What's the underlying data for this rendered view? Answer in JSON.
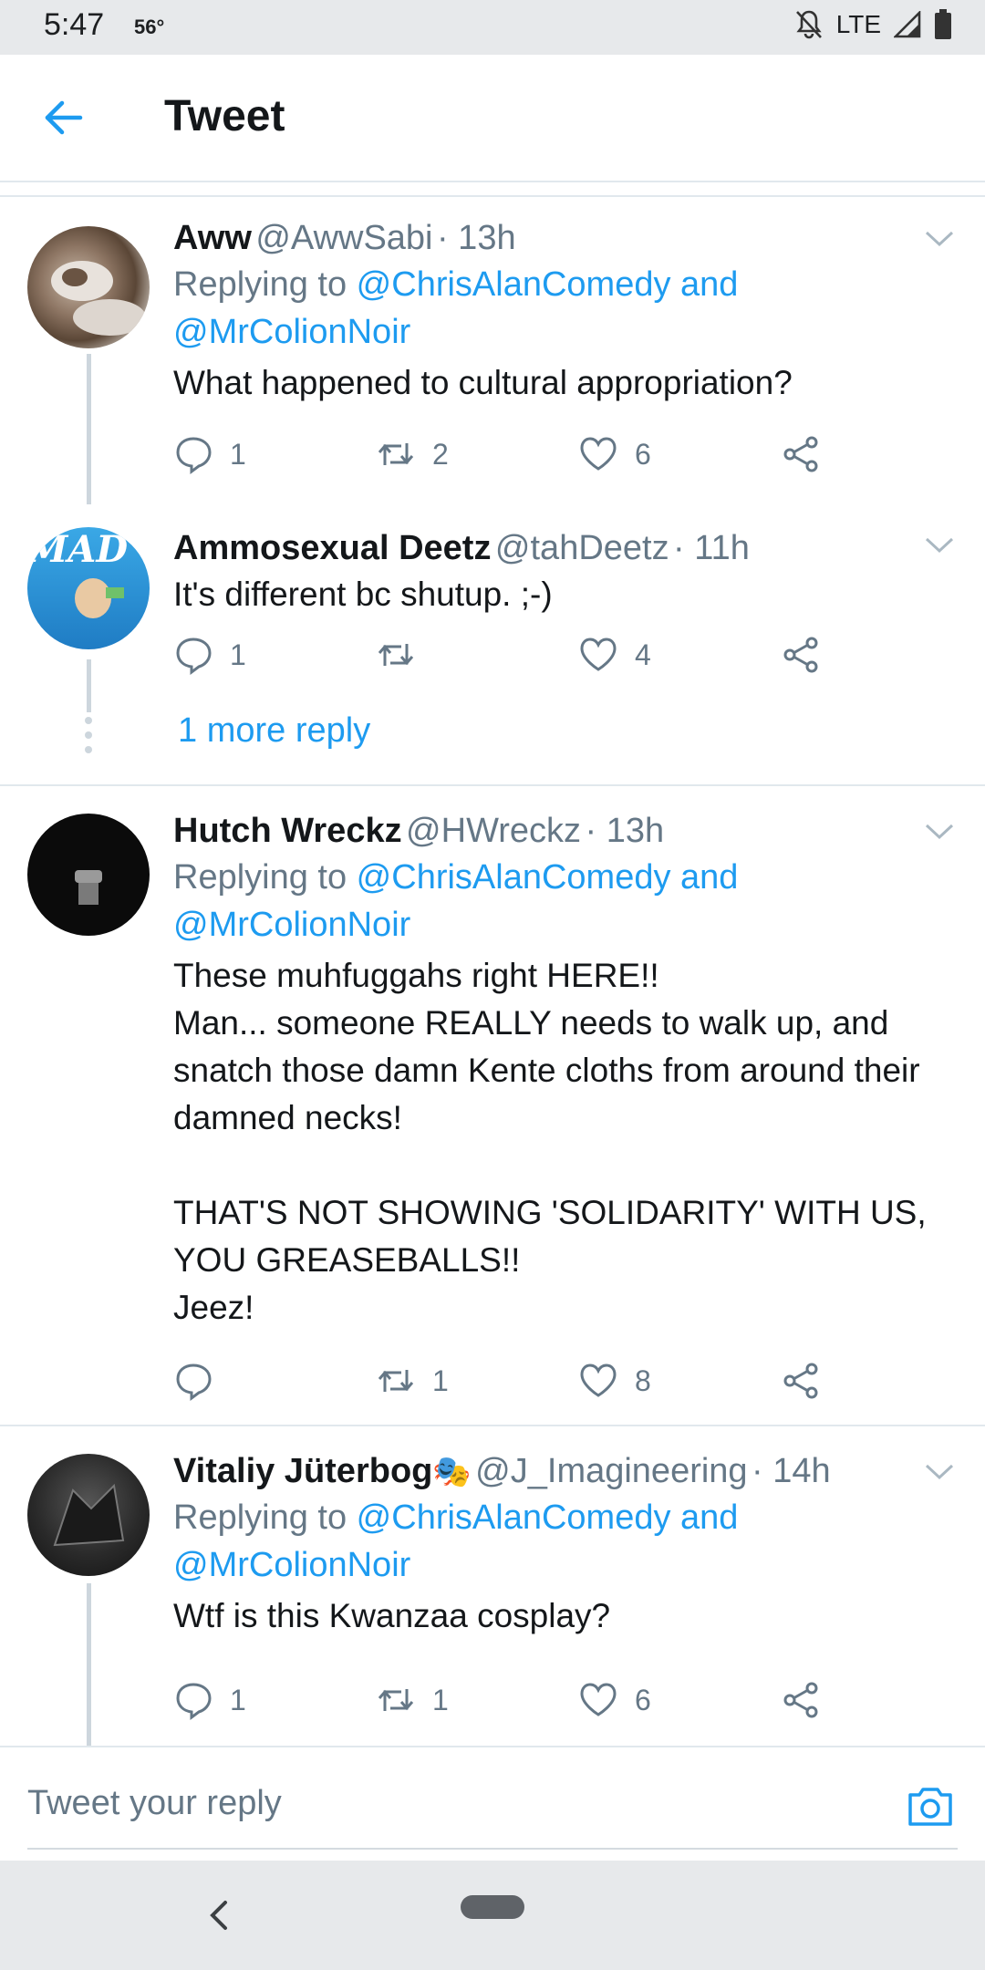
{
  "status": {
    "time": "5:47",
    "temp": "56°",
    "network": "LTE"
  },
  "header": {
    "title": "Tweet"
  },
  "tweets": [
    {
      "name": "Aww",
      "handle": "@AwwSabi",
      "time": "· 13h",
      "replying_prefix": "Replying to ",
      "replying_to": "@ChrisAlanComedy and",
      "replying_to2": "@MrColionNoir",
      "text": "What happened to cultural appropriation?",
      "replies": "1",
      "retweets": "2",
      "likes": "6"
    },
    {
      "name": "Ammosexual Deetz",
      "handle": "@tahDeetz",
      "time": "· 11h",
      "text": "It's different bc shutup. ;-)",
      "replies": "1",
      "retweets": "",
      "likes": "4",
      "more_replies": "1 more reply"
    },
    {
      "name": "Hutch Wreckz",
      "handle": "@HWreckz",
      "time": "· 13h",
      "replying_prefix": "Replying to ",
      "replying_to": "@ChrisAlanComedy and",
      "replying_to2": "@MrColionNoir",
      "text": "These muhfuggahs right HERE!!\nMan... someone REALLY needs to walk up, and snatch those damn Kente cloths from around their damned necks!\n\nTHAT'S NOT SHOWING 'SOLIDARITY' WITH US, YOU GREASEBALLS!!\nJeez!",
      "replies": "",
      "retweets": "1",
      "likes": "8"
    },
    {
      "name": "Vitaliy Jüterbog",
      "name_emoji": "🎭",
      "handle": "@J_Imagineering",
      "time": "· 14h",
      "replying_prefix": "Replying to ",
      "replying_to": "@ChrisAlanComedy and",
      "replying_to2": "@MrColionNoir",
      "text": "Wtf is this Kwanzaa cosplay?",
      "replies": "1",
      "retweets": "1",
      "likes": "6"
    }
  ],
  "composer": {
    "placeholder": "Tweet your reply"
  },
  "icons": {
    "back": "arrow-left-icon",
    "reply": "speech-bubble-icon",
    "retweet": "retweet-icon",
    "like": "heart-icon",
    "share": "share-icon",
    "caret": "chevron-down-icon",
    "camera": "camera-icon"
  },
  "colors": {
    "accent": "#1d9bf0",
    "muted": "#657786",
    "divider": "#e1e8ed"
  }
}
